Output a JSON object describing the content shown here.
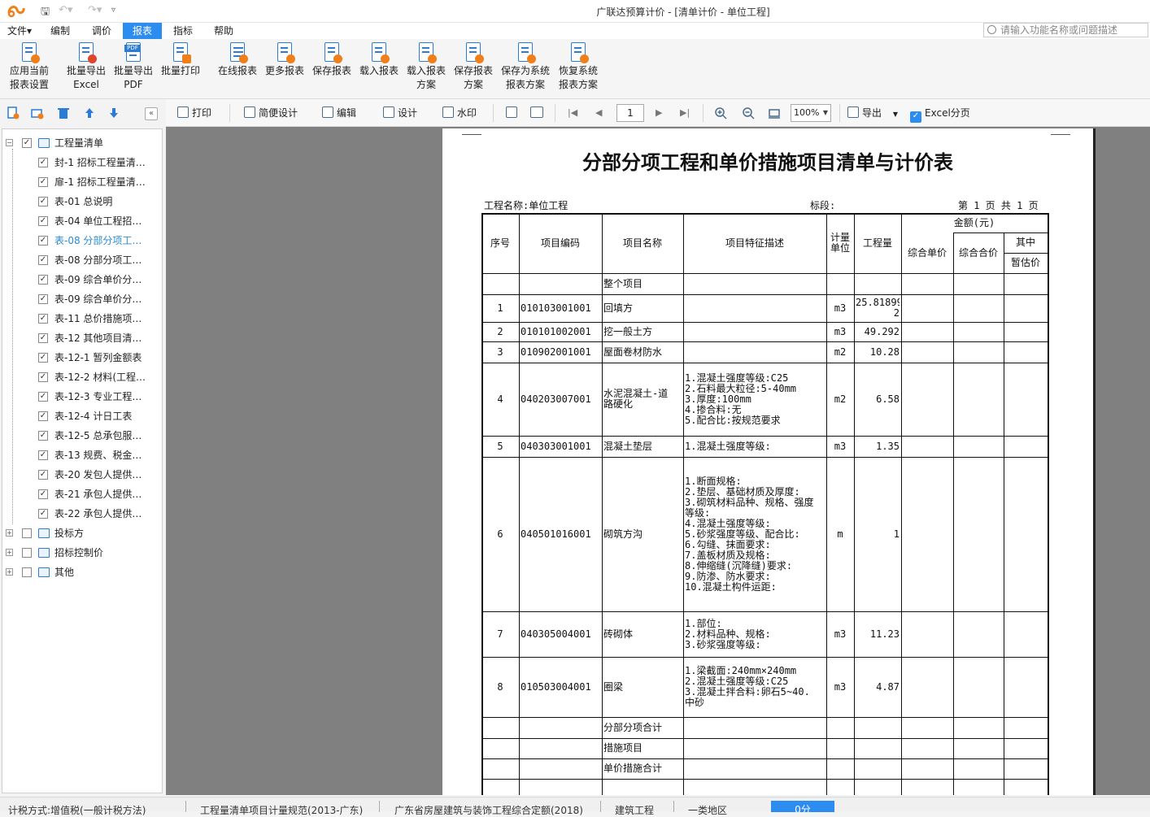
{
  "app": {
    "title": "广联达预算计价 - [清单计价 - 单位工程]"
  },
  "menu": {
    "items": [
      "文件▾",
      "编制",
      "调价",
      "报表",
      "指标",
      "帮助"
    ],
    "active": "报表"
  },
  "search": {
    "placeholder": "请输入功能名称或问题描述"
  },
  "ribbon": {
    "buttons": [
      {
        "line1": "应用当前",
        "line2": "报表设置",
        "icon": "apply-settings-icon"
      },
      {
        "line1": "批量导出",
        "line2": "Excel",
        "icon": "export-excel-icon"
      },
      {
        "line1": "批量导出",
        "line2": "PDF",
        "icon": "export-pdf-icon"
      },
      {
        "line1": "批量打印",
        "line2": "",
        "icon": "batch-print-icon"
      },
      {
        "line1": "在线报表",
        "line2": "",
        "icon": "online-report-icon"
      },
      {
        "line1": "更多报表",
        "line2": "",
        "icon": "more-reports-icon"
      },
      {
        "line1": "保存报表",
        "line2": "",
        "icon": "save-report-icon"
      },
      {
        "line1": "载入报表",
        "line2": "",
        "icon": "load-report-icon"
      },
      {
        "line1": "载入报表",
        "line2": "方案",
        "icon": "load-scheme-icon"
      },
      {
        "line1": "保存报表",
        "line2": "方案",
        "icon": "save-scheme-icon"
      },
      {
        "line1": "保存为系统",
        "line2": "报表方案",
        "icon": "save-system-scheme-icon"
      },
      {
        "line1": "恢复系统",
        "line2": "报表方案",
        "icon": "restore-system-scheme-icon"
      }
    ]
  },
  "viewer_toolbar": {
    "print": "打印",
    "simple_design": "简便设计",
    "edit": "编辑",
    "design": "设计",
    "watermark": "水印",
    "page": "1",
    "zoom": "100%",
    "export": "导出",
    "excel_split": "Excel分页"
  },
  "tree": {
    "items": [
      {
        "label": "工程量清单",
        "level": 0,
        "expand": "−",
        "checked": true
      },
      {
        "label": "封-1 招标工程量清…",
        "level": 1,
        "checked": true
      },
      {
        "label": "扉-1 招标工程量清…",
        "level": 1,
        "checked": true
      },
      {
        "label": "表-01 总说明",
        "level": 1,
        "checked": true
      },
      {
        "label": "表-04 单位工程招…",
        "level": 1,
        "checked": true
      },
      {
        "label": "表-08 分部分项工…",
        "level": 1,
        "checked": true,
        "selected": true
      },
      {
        "label": "表-08 分部分项工…",
        "level": 1,
        "checked": true
      },
      {
        "label": "表-09 综合单价分…",
        "level": 1,
        "checked": true
      },
      {
        "label": "表-09 综合单价分…",
        "level": 1,
        "checked": true
      },
      {
        "label": "表-11 总价措施项…",
        "level": 1,
        "checked": true
      },
      {
        "label": "表-12 其他项目清…",
        "level": 1,
        "checked": true
      },
      {
        "label": "表-12-1 暂列金额表",
        "level": 1,
        "checked": true
      },
      {
        "label": "表-12-2 材料(工程…",
        "level": 1,
        "checked": true
      },
      {
        "label": "表-12-3 专业工程…",
        "level": 1,
        "checked": true
      },
      {
        "label": "表-12-4 计日工表",
        "level": 1,
        "checked": true
      },
      {
        "label": "表-12-5 总承包服…",
        "level": 1,
        "checked": true
      },
      {
        "label": "表-13 规费、税金…",
        "level": 1,
        "checked": true
      },
      {
        "label": "表-20 发包人提供…",
        "level": 1,
        "checked": true
      },
      {
        "label": "表-21 承包人提供…",
        "level": 1,
        "checked": true
      },
      {
        "label": "表-22 承包人提供…",
        "level": 1,
        "checked": true
      },
      {
        "label": "投标方",
        "level": 0,
        "expand": "+",
        "checked": false
      },
      {
        "label": "招标控制价",
        "level": 0,
        "expand": "+",
        "checked": false
      },
      {
        "label": "其他",
        "level": 0,
        "expand": "+",
        "checked": false
      }
    ]
  },
  "report": {
    "title": "分部分项工程和单价措施项目清单与计价表",
    "project_name": "工程名称:单位工程",
    "section": "标段:",
    "page_info": "第 1 页  共 1 页",
    "headers": {
      "seq": "序号",
      "code": "项目编码",
      "name": "项目名称",
      "desc": "项目特征描述",
      "unit": "计量\n单位",
      "qty": "工程量",
      "amount": "金额(元)",
      "unit_price": "综合单价",
      "total": "综合合价",
      "of_which": "其中",
      "provisional": "暂估价"
    },
    "rows": [
      {
        "seq": "",
        "code": "",
        "name": "整个项目",
        "desc": "",
        "unit": "",
        "qty": ""
      },
      {
        "seq": "1",
        "code": "010103001001",
        "name": "回填方",
        "desc": "",
        "unit": "m3",
        "qty": "25.81899\n2"
      },
      {
        "seq": "2",
        "code": "010101002001",
        "name": "挖一般土方",
        "desc": "",
        "unit": "m3",
        "qty": "49.292"
      },
      {
        "seq": "3",
        "code": "010902001001",
        "name": "屋面卷材防水",
        "desc": "",
        "unit": "m2",
        "qty": "10.28"
      },
      {
        "seq": "4",
        "code": "040203007001",
        "name": "水泥混凝土-道\n路硬化",
        "desc": "1.混凝土强度等级:C25\n2.石料最大粒径:5-40mm\n3.厚度:100mm\n4.掺合料:无\n5.配合比:按规范要求",
        "unit": "m2",
        "qty": "6.58"
      },
      {
        "seq": "5",
        "code": "040303001001",
        "name": "混凝土垫层",
        "desc": "1.混凝土强度等级:",
        "unit": "m3",
        "qty": "1.35"
      },
      {
        "seq": "6",
        "code": "040501016001",
        "name": "砌筑方沟",
        "desc": "1.断面规格:\n2.垫层、基础材质及厚度:\n3.砌筑材料品种、规格、强度\n等级:\n4.混凝土强度等级:\n5.砂浆强度等级、配合比:\n6.勾缝、抹面要求:\n7.盖板材质及规格:\n8.伸缩缝(沉降缝)要求:\n9.防渗、防水要求:\n10.混凝土构件运距:",
        "unit": "m",
        "qty": "1"
      },
      {
        "seq": "7",
        "code": "040305004001",
        "name": "砖砌体",
        "desc": "1.部位:\n2.材料品种、规格:\n3.砂浆强度等级:",
        "unit": "m3",
        "qty": "11.23"
      },
      {
        "seq": "8",
        "code": "010503004001",
        "name": "圈梁",
        "desc": "1.梁截面:240mm×240mm\n2.混凝土强度等级:C25\n3.混凝土拌合料:卵石5~40.\n中砂",
        "unit": "m3",
        "qty": "4.87"
      },
      {
        "seq": "",
        "code": "",
        "name": "分部分项合计",
        "desc": "",
        "unit": "",
        "qty": ""
      },
      {
        "seq": "",
        "code": "",
        "name": "措施项目",
        "desc": "",
        "unit": "",
        "qty": ""
      },
      {
        "seq": "",
        "code": "",
        "name": "单价措施合计",
        "desc": "",
        "unit": "",
        "qty": ""
      }
    ]
  },
  "status": {
    "tax": "计税方式:增值税(一般计税方法)",
    "spec": "工程量清单项目计量规范(2013-广东)",
    "quota": "广东省房屋建筑与装饰工程综合定额(2018)",
    "type": "建筑工程",
    "region": "一类地区",
    "score": "0分"
  },
  "colors": {
    "accent": "#2d8cf0",
    "icon_blue": "#2b7bd7",
    "icon_orange": "#f07f1a",
    "canvas_gray": "#808080"
  }
}
